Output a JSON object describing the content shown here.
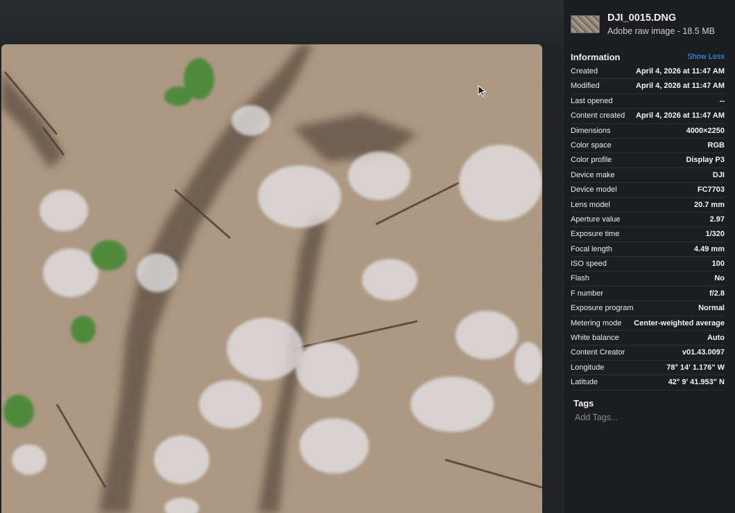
{
  "file": {
    "name": "DJI_0015.DNG",
    "subtitle": "Adobe raw image - 18.5 MB"
  },
  "info": {
    "title": "Information",
    "show_less_label": "Show Less",
    "rows": [
      {
        "label": "Created",
        "value": "April 4, 2026 at 11:47 AM"
      },
      {
        "label": "Modified",
        "value": "April 4, 2026 at 11:47 AM"
      },
      {
        "label": "Last opened",
        "value": "--"
      },
      {
        "label": "Content created",
        "value": "April 4, 2026 at 11:47 AM"
      },
      {
        "label": "Dimensions",
        "value": "4000×2250"
      },
      {
        "label": "Color space",
        "value": "RGB"
      },
      {
        "label": "Color profile",
        "value": "Display P3"
      },
      {
        "label": "Device make",
        "value": "DJI"
      },
      {
        "label": "Device model",
        "value": "FC7703"
      },
      {
        "label": "Lens model",
        "value": "20.7 mm"
      },
      {
        "label": "Aperture value",
        "value": "2.97"
      },
      {
        "label": "Exposure time",
        "value": "1/320"
      },
      {
        "label": "Focal length",
        "value": "4.49 mm"
      },
      {
        "label": "ISO speed",
        "value": "100"
      },
      {
        "label": "Flash",
        "value": "No"
      },
      {
        "label": "F number",
        "value": "f/2.8"
      },
      {
        "label": "Exposure program",
        "value": "Normal"
      },
      {
        "label": "Metering mode",
        "value": "Center-weighted average"
      },
      {
        "label": "White balance",
        "value": "Auto"
      },
      {
        "label": "Content Creator",
        "value": "v01.43.0097"
      },
      {
        "label": "Longitude",
        "value": "78° 14' 1.176\" W"
      },
      {
        "label": "Latitude",
        "value": "42° 9' 41.953\" N"
      }
    ]
  },
  "tags": {
    "title": "Tags",
    "placeholder": "Add Tags..."
  },
  "photo": {
    "description_icon": "aerial-forest-photo"
  },
  "colors": {
    "panel_bg": "#1c1d20",
    "accent": "#3d9bff"
  }
}
